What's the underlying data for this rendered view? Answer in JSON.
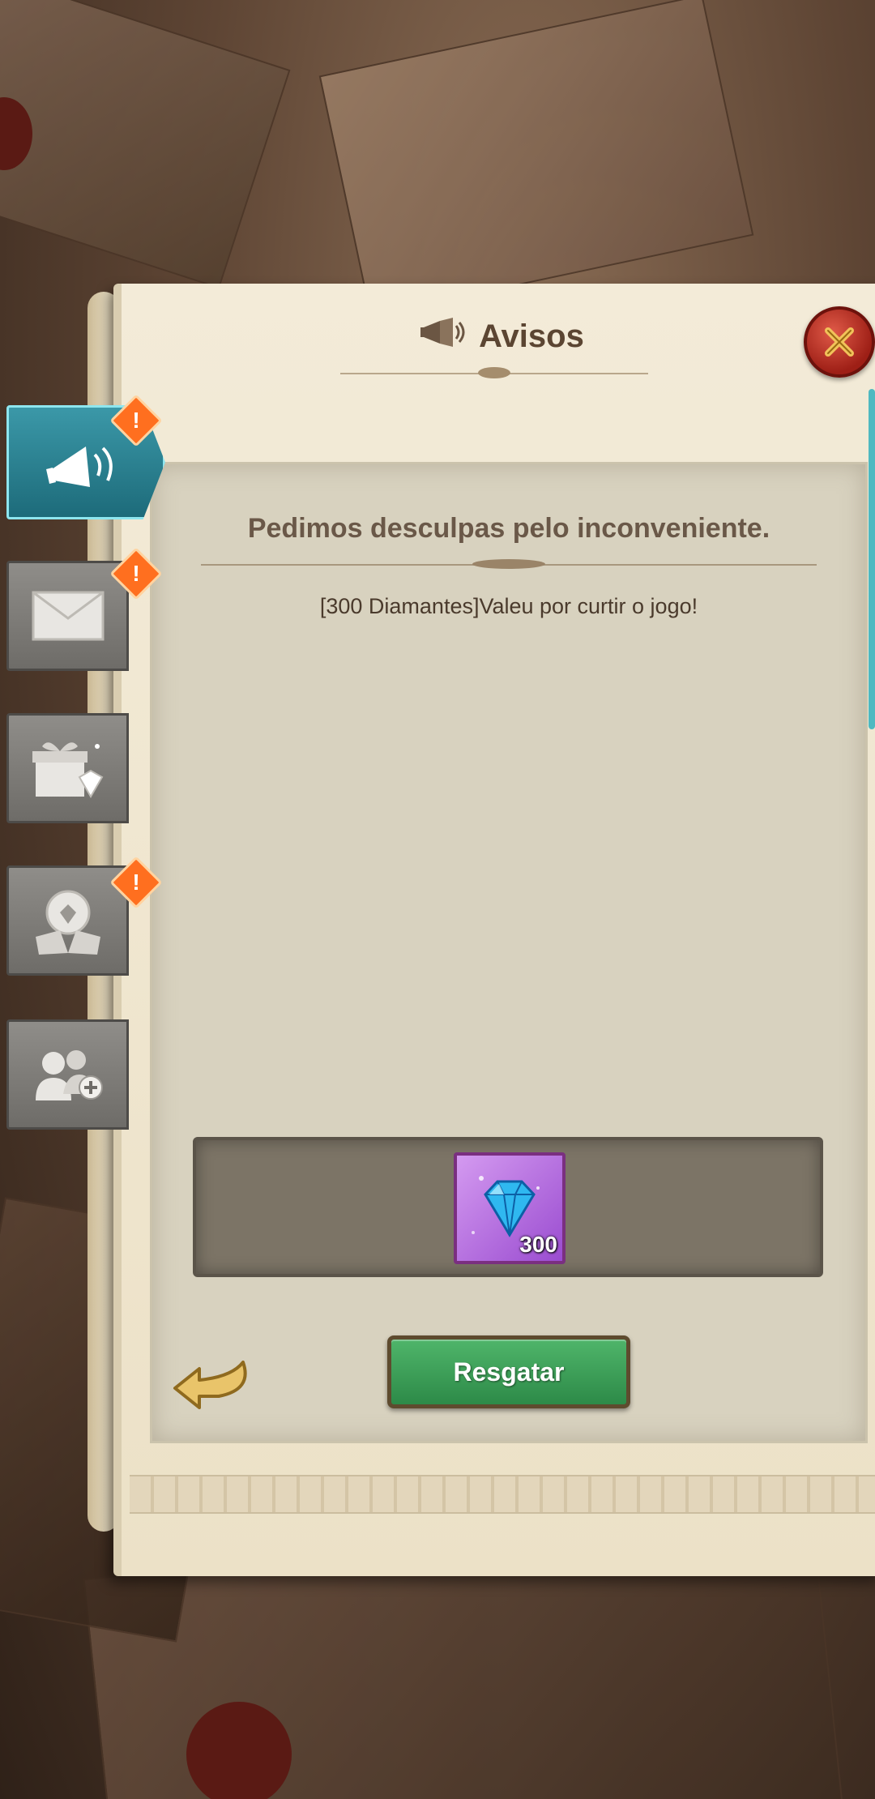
{
  "header": {
    "title": "Avisos"
  },
  "tabs": [
    {
      "name": "announcements",
      "icon": "megaphone-icon",
      "active": true,
      "badge": "!"
    },
    {
      "name": "mail",
      "icon": "envelope-icon",
      "active": false,
      "badge": "!"
    },
    {
      "name": "gifts",
      "icon": "gift-box-icon",
      "active": false,
      "badge": ""
    },
    {
      "name": "rewards",
      "icon": "trophy-hands-icon",
      "active": false,
      "badge": "!"
    },
    {
      "name": "friends",
      "icon": "add-friend-icon",
      "active": false,
      "badge": ""
    }
  ],
  "notice": {
    "heading": "Pedimos desculpas pelo inconveniente.",
    "body": "[300 Diamantes]Valeu por curtir o jogo!"
  },
  "reward": {
    "icon": "diamond-icon",
    "quantity": "300"
  },
  "actions": {
    "claim_label": "Resgatar"
  },
  "colors": {
    "accent_teal": "#2a8696",
    "claim_green": "#3aa058",
    "badge_orange": "#ff6f1f",
    "close_red": "#c0392b"
  }
}
